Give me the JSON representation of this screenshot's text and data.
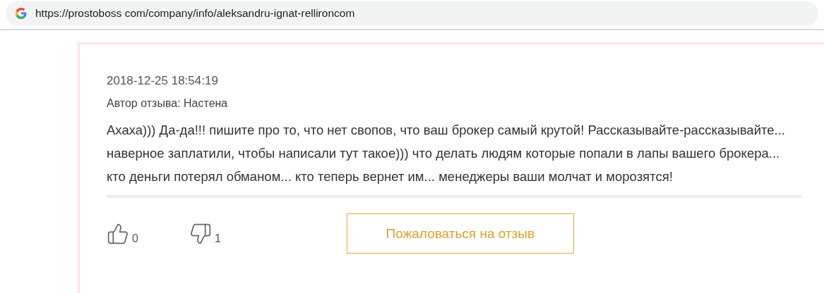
{
  "address_bar": {
    "url": "https://prostoboss com/company/info/aleksandru-ignat-rellironcom"
  },
  "review": {
    "date": "2018-12-25 18:54:19",
    "author": "Автор отзыва: Настена",
    "text": "Ахаха))) Да-да!!! пишите про то, что нет свопов, что ваш брокер самый крутой! Рассказывайте-рассказывайте... наверное заплатили, чтобы написали тут такое))) что делать людям которые попали в лапы вашего брокера... кто деньги потерял обманом... кто теперь вернет им... менеджеры ваши молчат и морозятся!",
    "likes": "0",
    "dislikes": "1",
    "report_button": "Пожаловаться на отзыв"
  }
}
